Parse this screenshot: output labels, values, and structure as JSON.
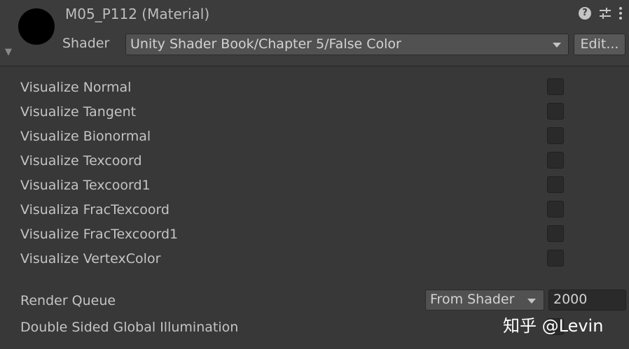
{
  "header": {
    "material_name": "M05_P112 (Material)",
    "shader_label": "Shader",
    "shader_value": "Unity Shader Book/Chapter 5/False Color",
    "edit_label": "Edit...",
    "help_symbol": "?",
    "icons": [
      "material-preview",
      "help-icon",
      "preset-icon",
      "kebab-menu-icon",
      "foldout-arrow-icon"
    ]
  },
  "properties": [
    {
      "label": "Visualize Normal",
      "checked": false
    },
    {
      "label": "Visualize Tangent",
      "checked": false
    },
    {
      "label": "Visualize Bionormal",
      "checked": false
    },
    {
      "label": "Visualize Texcoord",
      "checked": false
    },
    {
      "label": "Visualiza Texcoord1",
      "checked": false
    },
    {
      "label": "Visualiza FracTexcoord",
      "checked": false
    },
    {
      "label": "Visualize FracTexcoord1",
      "checked": false
    },
    {
      "label": "Visualize VertexColor",
      "checked": false
    }
  ],
  "render_queue": {
    "label": "Render Queue",
    "mode": "From Shader",
    "value": "2000"
  },
  "double_sided_gi": {
    "label": "Double Sided Global Illumination",
    "checked": false
  },
  "watermark": "知乎 @Levin"
}
